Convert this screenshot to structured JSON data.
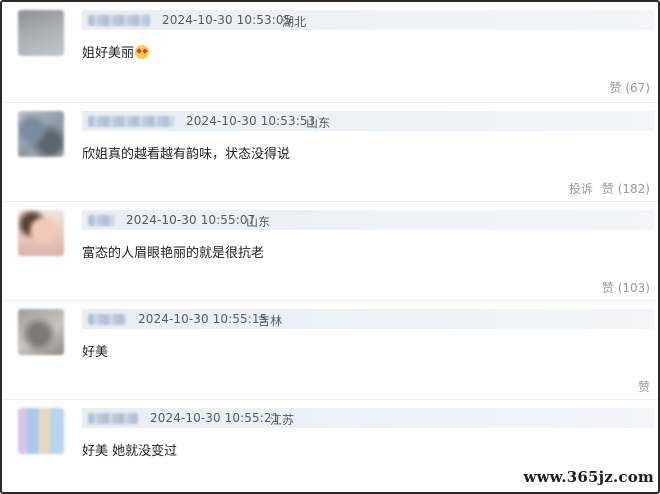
{
  "comments": [
    {
      "timestamp": "2024-10-30 10:53:05",
      "location": "湖北",
      "text": "姐好美丽",
      "emoji": "heart-eyes-emoji",
      "actions": [
        "赞 (67)"
      ]
    },
    {
      "timestamp": "2024-10-30 10:53:53",
      "location": "山东",
      "text": "欣姐真的越看越有韵味，状态没得说",
      "actions": [
        "投诉",
        "赞 (182)"
      ]
    },
    {
      "timestamp": "2024-10-30 10:55:07",
      "location": "山东",
      "text": "富态的人眉眼艳丽的就是很抗老",
      "actions": [
        "赞 (103)"
      ]
    },
    {
      "timestamp": "2024-10-30 10:55:15",
      "location": "吉林",
      "text": "好美",
      "actions": [
        "赞"
      ]
    },
    {
      "timestamp": "2024-10-30 10:55:21",
      "location": "江苏",
      "text": "好美 她就没变过",
      "actions": []
    }
  ],
  "watermark": "www.365jz.com",
  "colors": {
    "meta_bar": "#eef2f7",
    "action_text": "#9a9a9a",
    "meta_text": "#555a61"
  }
}
